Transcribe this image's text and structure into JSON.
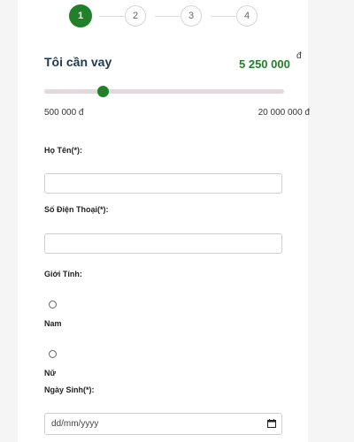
{
  "stepper": {
    "steps": [
      "1",
      "2",
      "3",
      "4"
    ],
    "active_step": 1
  },
  "loan": {
    "label": "Tôi cần vay",
    "amount": "5 250 000",
    "currency": "đ",
    "min_label": "500 000 đ",
    "max_label": "20 000 000 đ",
    "min_value": 500000,
    "max_value": 20000000,
    "value": 5250000
  },
  "form": {
    "name_label": "Họ Tên(*):",
    "name_value": "",
    "phone_label": "Số Điện Thoại(*):",
    "phone_value": "",
    "gender_label": "Giới Tính:",
    "gender_options": [
      "Nam",
      "Nữ"
    ],
    "dob_label": "Ngày Sinh(*):",
    "dob_placeholder": "dd/mm/yyyy"
  },
  "colors": {
    "accent": "#22802a",
    "track": "#e3d9dc"
  },
  "icons": {
    "date_picker": "calendar-icon"
  }
}
